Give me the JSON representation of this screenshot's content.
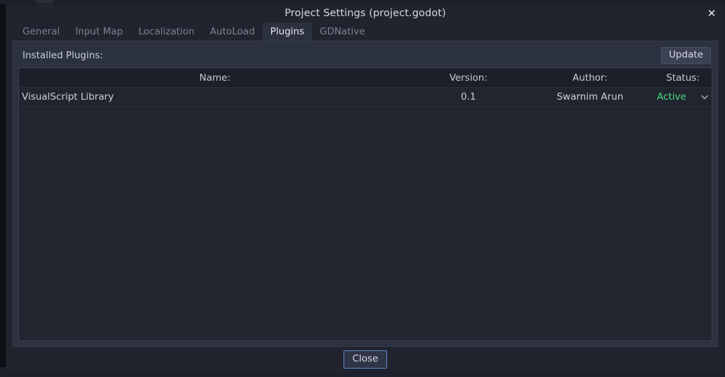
{
  "window": {
    "title": "Project Settings (project.godot)",
    "close_icon": "close-x-icon"
  },
  "tabs": [
    {
      "label": "General",
      "active": false
    },
    {
      "label": "Input Map",
      "active": false
    },
    {
      "label": "Localization",
      "active": false
    },
    {
      "label": "AutoLoad",
      "active": false
    },
    {
      "label": "Plugins",
      "active": true
    },
    {
      "label": "GDNative",
      "active": false
    }
  ],
  "plugins_panel": {
    "header_label": "Installed Plugins:",
    "update_button": "Update",
    "columns": {
      "name": "Name:",
      "version": "Version:",
      "author": "Author:",
      "status": "Status:"
    },
    "rows": [
      {
        "name": "VisualScript Library",
        "version": "0.1",
        "author": "Swarnim Arun",
        "status": "Active",
        "status_color": "#4bdb7f",
        "dropdown_icon": "chevron-down-icon"
      }
    ]
  },
  "footer": {
    "close_button": "Close"
  },
  "backdrop": {
    "status_left": "",
    "status_right": ""
  },
  "colors": {
    "dialog_bg": "#21242e",
    "panel_bg": "#2c3140",
    "list_bg": "#21252f",
    "list_header_bg": "#1c1f29",
    "accent_focus": "#5a8ad6",
    "status_active": "#4bdb7f",
    "text_primary": "#d4d9e4",
    "text_muted": "#7a8296"
  }
}
